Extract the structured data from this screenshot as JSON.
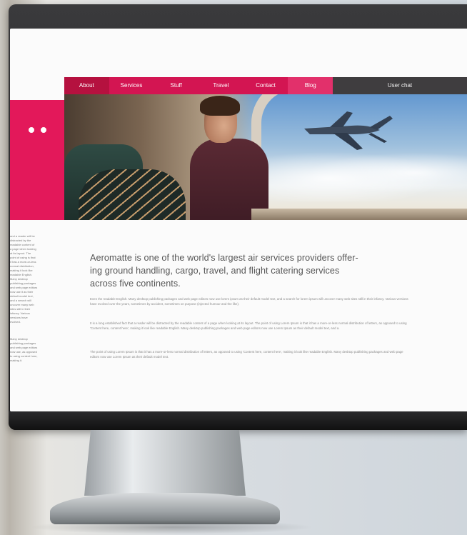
{
  "nav": {
    "items": [
      "About",
      "Services",
      "Stuff",
      "Travel",
      "Contact",
      "Blog"
    ],
    "right_label": "User chat"
  },
  "headline": "Aeromatte is one of the world's largest air services providers offer-\ning ground handling, cargo, travel, and flight catering services\nacross five continents.",
  "paragraphs": [
    "Even the readable English. Many desktop publishing packages and web page editors now use lorem ipsum as their default model text, and a search for lorem ipsum will uncover many web sites still in their infancy. Various versions have evolved over the years, sometimes by accident, sometimes on purpose (injected humour and the like).",
    "It is a long established fact that a reader will be distracted by the readable content of a page when looking at its layout. The point of using Lorem Ipsum is that it has a more-or-less normal distribution of letters, as opposed to using 'Content here, content here', making it look like readable English. Many desktop publishing packages and web page editors now use Lorem Ipsum as their default model text, and a.",
    "The point of using Lorem Ipsum is that it has a more-or-less normal distribution of letters, as opposed to using 'Content here, content here', making it look like readable English. Many desktop publishing packages and web page editors now use Lorem Ipsum as their default model text."
  ],
  "sidebar": {
    "text1": "and a reader will be\ndistracted by the\nreadable content of\na page when looking\nat its layout. The\npoint of using is that\nit has a more-or-less\nnormal distribution,\nmaking it look like\nreadable English.\nMany desktop\npublishing packages\nand web page editors\nnow use it as their\ndefault model text,\nand a search will\nuncover many web\nsites still in their\ninfancy. Various\nversions have\nevolved.",
    "text2": "Many desktop\npublishing packages\nand web page editors\nnow use, as opposed\nto using content here,\nmaking it."
  },
  "colors": {
    "accent": "#e3185a",
    "nav_bg": "#d31552",
    "nav_right_bg": "#3f3d3f"
  }
}
